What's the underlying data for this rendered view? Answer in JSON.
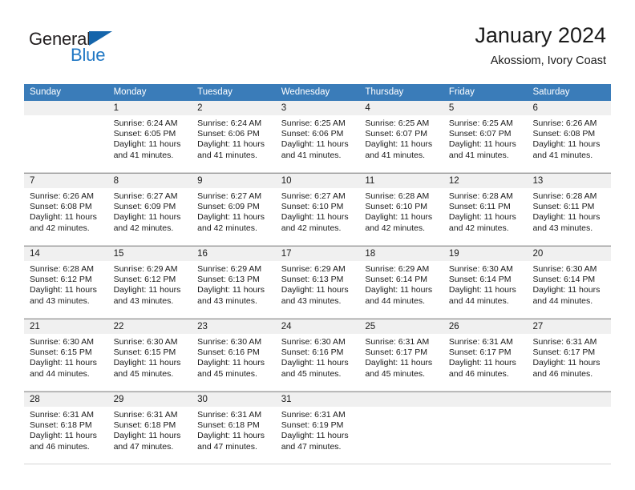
{
  "logo": {
    "word_top": "General",
    "word_bottom": "Blue",
    "flag_icon": "triangle-flag-icon",
    "color_dark": "#231f20",
    "color_blue": "#2178c4"
  },
  "header": {
    "title": "January 2024",
    "subtitle": "Akossiom, Ivory Coast"
  },
  "colors": {
    "header_band": "#3a7cb9",
    "daynum_band": "#f0f0f0",
    "text": "#1a1a1a"
  },
  "calendar": {
    "weekday_headers": [
      "Sunday",
      "Monday",
      "Tuesday",
      "Wednesday",
      "Thursday",
      "Friday",
      "Saturday"
    ],
    "weeks": [
      [
        {
          "day": "",
          "lines": []
        },
        {
          "day": "1",
          "lines": [
            "Sunrise: 6:24 AM",
            "Sunset: 6:05 PM",
            "Daylight: 11 hours",
            "and 41 minutes."
          ]
        },
        {
          "day": "2",
          "lines": [
            "Sunrise: 6:24 AM",
            "Sunset: 6:06 PM",
            "Daylight: 11 hours",
            "and 41 minutes."
          ]
        },
        {
          "day": "3",
          "lines": [
            "Sunrise: 6:25 AM",
            "Sunset: 6:06 PM",
            "Daylight: 11 hours",
            "and 41 minutes."
          ]
        },
        {
          "day": "4",
          "lines": [
            "Sunrise: 6:25 AM",
            "Sunset: 6:07 PM",
            "Daylight: 11 hours",
            "and 41 minutes."
          ]
        },
        {
          "day": "5",
          "lines": [
            "Sunrise: 6:25 AM",
            "Sunset: 6:07 PM",
            "Daylight: 11 hours",
            "and 41 minutes."
          ]
        },
        {
          "day": "6",
          "lines": [
            "Sunrise: 6:26 AM",
            "Sunset: 6:08 PM",
            "Daylight: 11 hours",
            "and 41 minutes."
          ]
        }
      ],
      [
        {
          "day": "7",
          "lines": [
            "Sunrise: 6:26 AM",
            "Sunset: 6:08 PM",
            "Daylight: 11 hours",
            "and 42 minutes."
          ]
        },
        {
          "day": "8",
          "lines": [
            "Sunrise: 6:27 AM",
            "Sunset: 6:09 PM",
            "Daylight: 11 hours",
            "and 42 minutes."
          ]
        },
        {
          "day": "9",
          "lines": [
            "Sunrise: 6:27 AM",
            "Sunset: 6:09 PM",
            "Daylight: 11 hours",
            "and 42 minutes."
          ]
        },
        {
          "day": "10",
          "lines": [
            "Sunrise: 6:27 AM",
            "Sunset: 6:10 PM",
            "Daylight: 11 hours",
            "and 42 minutes."
          ]
        },
        {
          "day": "11",
          "lines": [
            "Sunrise: 6:28 AM",
            "Sunset: 6:10 PM",
            "Daylight: 11 hours",
            "and 42 minutes."
          ]
        },
        {
          "day": "12",
          "lines": [
            "Sunrise: 6:28 AM",
            "Sunset: 6:11 PM",
            "Daylight: 11 hours",
            "and 42 minutes."
          ]
        },
        {
          "day": "13",
          "lines": [
            "Sunrise: 6:28 AM",
            "Sunset: 6:11 PM",
            "Daylight: 11 hours",
            "and 43 minutes."
          ]
        }
      ],
      [
        {
          "day": "14",
          "lines": [
            "Sunrise: 6:28 AM",
            "Sunset: 6:12 PM",
            "Daylight: 11 hours",
            "and 43 minutes."
          ]
        },
        {
          "day": "15",
          "lines": [
            "Sunrise: 6:29 AM",
            "Sunset: 6:12 PM",
            "Daylight: 11 hours",
            "and 43 minutes."
          ]
        },
        {
          "day": "16",
          "lines": [
            "Sunrise: 6:29 AM",
            "Sunset: 6:13 PM",
            "Daylight: 11 hours",
            "and 43 minutes."
          ]
        },
        {
          "day": "17",
          "lines": [
            "Sunrise: 6:29 AM",
            "Sunset: 6:13 PM",
            "Daylight: 11 hours",
            "and 43 minutes."
          ]
        },
        {
          "day": "18",
          "lines": [
            "Sunrise: 6:29 AM",
            "Sunset: 6:14 PM",
            "Daylight: 11 hours",
            "and 44 minutes."
          ]
        },
        {
          "day": "19",
          "lines": [
            "Sunrise: 6:30 AM",
            "Sunset: 6:14 PM",
            "Daylight: 11 hours",
            "and 44 minutes."
          ]
        },
        {
          "day": "20",
          "lines": [
            "Sunrise: 6:30 AM",
            "Sunset: 6:14 PM",
            "Daylight: 11 hours",
            "and 44 minutes."
          ]
        }
      ],
      [
        {
          "day": "21",
          "lines": [
            "Sunrise: 6:30 AM",
            "Sunset: 6:15 PM",
            "Daylight: 11 hours",
            "and 44 minutes."
          ]
        },
        {
          "day": "22",
          "lines": [
            "Sunrise: 6:30 AM",
            "Sunset: 6:15 PM",
            "Daylight: 11 hours",
            "and 45 minutes."
          ]
        },
        {
          "day": "23",
          "lines": [
            "Sunrise: 6:30 AM",
            "Sunset: 6:16 PM",
            "Daylight: 11 hours",
            "and 45 minutes."
          ]
        },
        {
          "day": "24",
          "lines": [
            "Sunrise: 6:30 AM",
            "Sunset: 6:16 PM",
            "Daylight: 11 hours",
            "and 45 minutes."
          ]
        },
        {
          "day": "25",
          "lines": [
            "Sunrise: 6:31 AM",
            "Sunset: 6:17 PM",
            "Daylight: 11 hours",
            "and 45 minutes."
          ]
        },
        {
          "day": "26",
          "lines": [
            "Sunrise: 6:31 AM",
            "Sunset: 6:17 PM",
            "Daylight: 11 hours",
            "and 46 minutes."
          ]
        },
        {
          "day": "27",
          "lines": [
            "Sunrise: 6:31 AM",
            "Sunset: 6:17 PM",
            "Daylight: 11 hours",
            "and 46 minutes."
          ]
        }
      ],
      [
        {
          "day": "28",
          "lines": [
            "Sunrise: 6:31 AM",
            "Sunset: 6:18 PM",
            "Daylight: 11 hours",
            "and 46 minutes."
          ]
        },
        {
          "day": "29",
          "lines": [
            "Sunrise: 6:31 AM",
            "Sunset: 6:18 PM",
            "Daylight: 11 hours",
            "and 47 minutes."
          ]
        },
        {
          "day": "30",
          "lines": [
            "Sunrise: 6:31 AM",
            "Sunset: 6:18 PM",
            "Daylight: 11 hours",
            "and 47 minutes."
          ]
        },
        {
          "day": "31",
          "lines": [
            "Sunrise: 6:31 AM",
            "Sunset: 6:19 PM",
            "Daylight: 11 hours",
            "and 47 minutes."
          ]
        },
        {
          "day": "",
          "lines": []
        },
        {
          "day": "",
          "lines": []
        },
        {
          "day": "",
          "lines": []
        }
      ]
    ]
  }
}
